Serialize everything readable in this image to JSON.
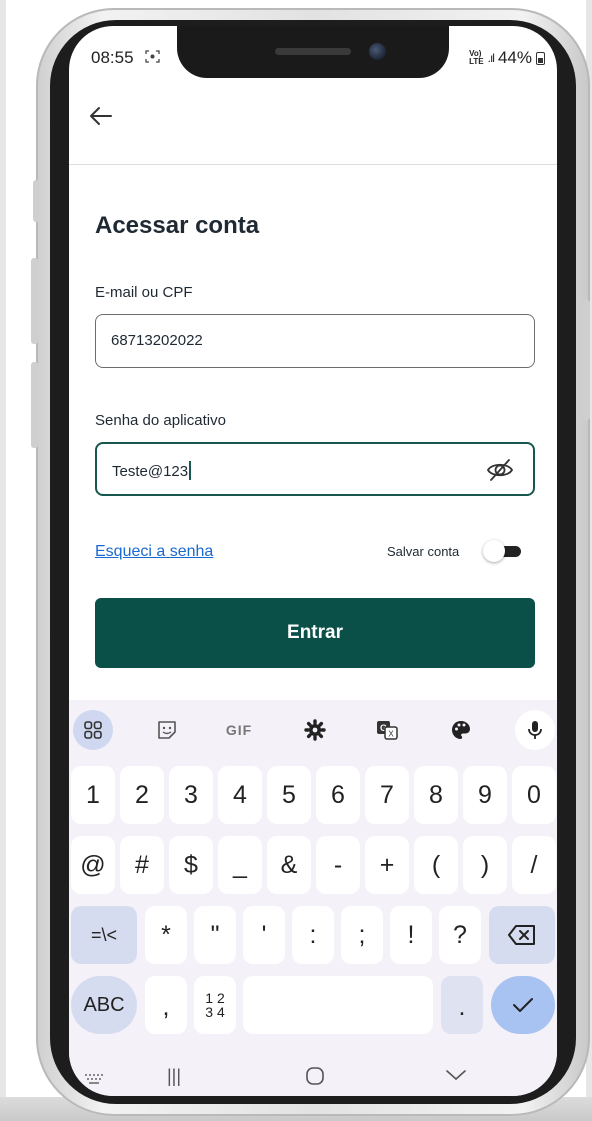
{
  "status_bar": {
    "time": "08:55",
    "screen_record_icon": "screen-record-icon",
    "network": "Vo) LTE",
    "battery": "44%"
  },
  "app": {
    "title": "Acessar conta",
    "back_icon": "back-arrow-icon",
    "email": {
      "label": "E-mail ou CPF",
      "value": "68713202022"
    },
    "password": {
      "label": "Senha do aplicativo",
      "value": "Teste@123",
      "visibility_icon": "eye-off-icon"
    },
    "forgot_link": "Esqueci a senha",
    "save_account": {
      "label": "Salvar conta",
      "enabled": false
    },
    "submit_label": "Entrar",
    "colors": {
      "primary": "#0b4f49",
      "link": "#1a6ad4",
      "focus_border": "#17574f"
    }
  },
  "keyboard": {
    "toolbar": {
      "apps_icon": "apps-grid-icon",
      "sticker_icon": "sticker-icon",
      "gif_label": "GIF",
      "settings_icon": "gear-icon",
      "translate_icon": "translate-icon",
      "theme_icon": "palette-icon",
      "mic_icon": "mic-icon"
    },
    "row1": [
      "1",
      "2",
      "3",
      "4",
      "5",
      "6",
      "7",
      "8",
      "9",
      "0"
    ],
    "row2": [
      "@",
      "#",
      "$",
      "_",
      "&",
      "-",
      "+",
      "(",
      ")",
      "/"
    ],
    "row3": [
      "=\\<",
      "*",
      "\"",
      "'",
      ":",
      ";",
      "!",
      "?"
    ],
    "backspace_icon": "backspace-icon",
    "row4": {
      "abc": "ABC",
      "comma": ",",
      "numpad_top": "1 2",
      "numpad_bottom": "3 4",
      "period": ".",
      "done_icon": "check-icon"
    }
  },
  "nav_bar": {
    "keyboard_icon": "keyboard-icon",
    "recents": "|||",
    "home_icon": "home-icon",
    "back_icon": "chevron-down-icon"
  }
}
